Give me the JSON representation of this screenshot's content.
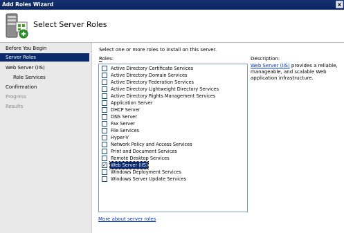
{
  "window": {
    "title": "Add Roles Wizard",
    "close_label": "x"
  },
  "header": {
    "title": "Select Server Roles",
    "icon": "server-roles-wizard-icon"
  },
  "nav": {
    "items": [
      {
        "label": "Before You Begin",
        "state": "normal"
      },
      {
        "label": "Server Roles",
        "state": "selected"
      },
      {
        "label": "Web Server (IIS)",
        "state": "normal"
      },
      {
        "label": "Role Services",
        "state": "normal"
      },
      {
        "label": "Confirmation",
        "state": "normal"
      },
      {
        "label": "Progress",
        "state": "disabled"
      },
      {
        "label": "Results",
        "state": "disabled"
      }
    ]
  },
  "main": {
    "intro": "Select one or more roles to install on this server.",
    "roles_label_accel": "R",
    "roles_label_rest": "oles:",
    "roles": [
      {
        "label": "Active Directory Certificate Services",
        "checked": false
      },
      {
        "label": "Active Directory Domain Services",
        "checked": false
      },
      {
        "label": "Active Directory Federation Services",
        "checked": false
      },
      {
        "label": "Active Directory Lightweight Directory Services",
        "checked": false
      },
      {
        "label": "Active Directory Rights Management Services",
        "checked": false
      },
      {
        "label": "Application Server",
        "checked": false
      },
      {
        "label": "DHCP Server",
        "checked": false
      },
      {
        "label": "DNS Server",
        "checked": false
      },
      {
        "label": "Fax Server",
        "checked": false
      },
      {
        "label": "File Services",
        "checked": false
      },
      {
        "label": "Hyper-V",
        "checked": false
      },
      {
        "label": "Network Policy and Access Services",
        "checked": false
      },
      {
        "label": "Print and Document Services",
        "checked": false
      },
      {
        "label": "Remote Desktop Services",
        "checked": false
      },
      {
        "label": "Web Server (IIS)",
        "checked": true,
        "selected": true
      },
      {
        "label": "Windows Deployment Services",
        "checked": false
      },
      {
        "label": "Windows Server Update Services",
        "checked": false
      }
    ],
    "description": {
      "label": "Description:",
      "link": "Web Server (IIS)",
      "text": " provides a reliable, manageable, and scalable Web application infrastructure."
    },
    "more_link": "More about server roles"
  }
}
